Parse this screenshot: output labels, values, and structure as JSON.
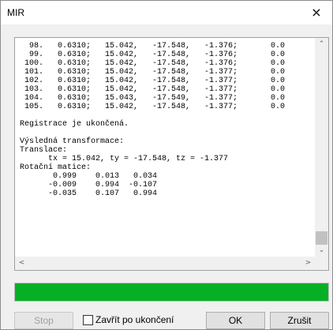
{
  "window": {
    "title": "MIR"
  },
  "log": {
    "lines": [
      "  98.   0.6310;   15.042,   -17.548,   -1.376;       0.0",
      "  99.   0.6310;   15.042,   -17.548,   -1.376;       0.0",
      " 100.   0.6310;   15.042,   -17.548,   -1.376;       0.0",
      " 101.   0.6310;   15.042,   -17.548,   -1.377;       0.0",
      " 102.   0.6310;   15.042,   -17.548,   -1.377;       0.0",
      " 103.   0.6310;   15.042,   -17.548,   -1.377;       0.0",
      " 104.   0.6310;   15.043,   -17.549,   -1.377;       0.0",
      " 105.   0.6310;   15.042,   -17.548,   -1.377;       0.0",
      "",
      "Registrace je ukončená.",
      "",
      "Výsledná transformace:",
      "Translace:",
      "      tx = 15.042, ty = -17.548, tz = -1.377",
      "Rotační matice:",
      "       0.999    0.013   0.034",
      "      -0.009    0.994  -0.107",
      "      -0.035    0.107   0.994"
    ]
  },
  "progress": {
    "fraction": 1.0,
    "color": "#06b025"
  },
  "buttons": {
    "stop_label": "Stop",
    "close_after_label": "Zavřít po ukončení",
    "ok_label": "OK",
    "cancel_label": "Zrušit"
  },
  "icons": {
    "close": "×",
    "up": "⌃",
    "down": "⌄",
    "left": "<",
    "right": ">"
  }
}
